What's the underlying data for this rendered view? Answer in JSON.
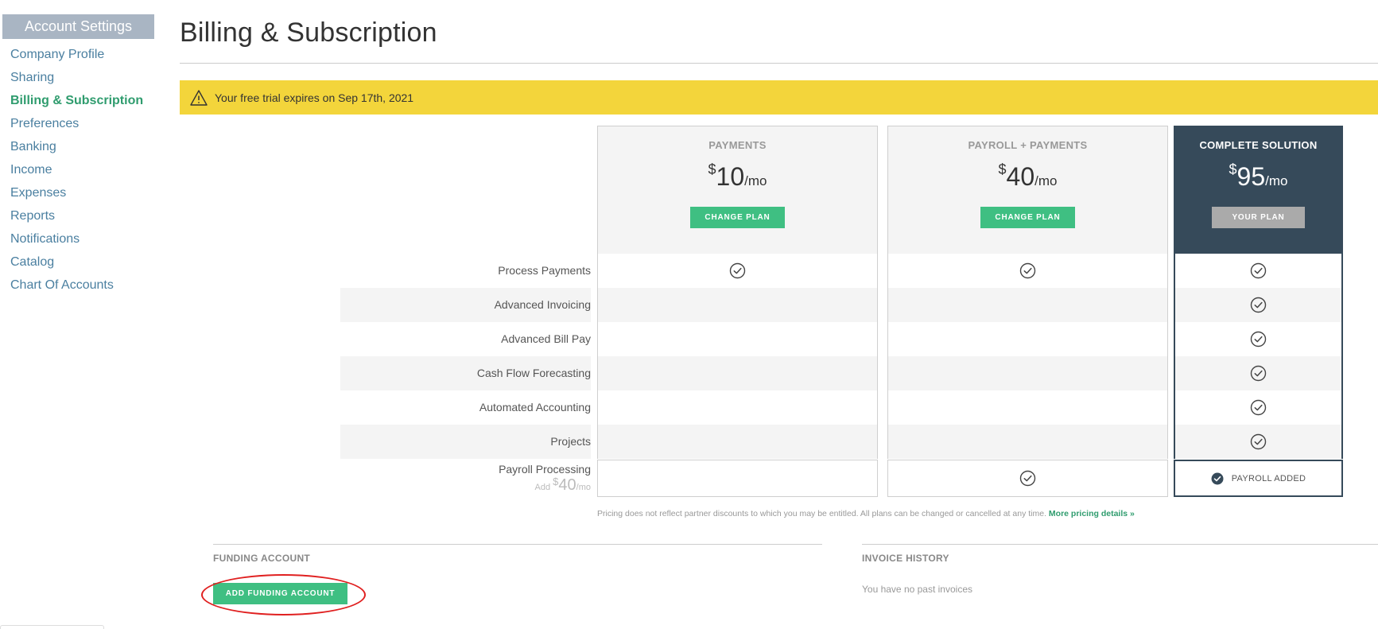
{
  "sidebar": {
    "header": "Account Settings",
    "items": [
      {
        "label": "Company Profile"
      },
      {
        "label": "Sharing"
      },
      {
        "label": "Billing & Subscription",
        "active": true
      },
      {
        "label": "Preferences"
      },
      {
        "label": "Banking"
      },
      {
        "label": "Income"
      },
      {
        "label": "Expenses"
      },
      {
        "label": "Reports"
      },
      {
        "label": "Notifications"
      },
      {
        "label": "Catalog"
      },
      {
        "label": "Chart Of Accounts"
      }
    ]
  },
  "page": {
    "title": "Billing & Subscription"
  },
  "banner": {
    "text": "Your free trial expires on Sep 17th, 2021",
    "icon": "warning-icon",
    "color": "#f3d53b"
  },
  "plans": [
    {
      "name": "PAYMENTS",
      "currency": "$",
      "price": "10",
      "unit": "/mo",
      "button": "CHANGE PLAN"
    },
    {
      "name": "PAYROLL + PAYMENTS",
      "currency": "$",
      "price": "40",
      "unit": "/mo",
      "button": "CHANGE PLAN"
    },
    {
      "name": "COMPLETE SOLUTION",
      "currency": "$",
      "price": "95",
      "unit": "/mo",
      "button": "YOUR PLAN",
      "current": true
    }
  ],
  "features": [
    {
      "label": "Process Payments",
      "included": [
        true,
        true,
        true
      ]
    },
    {
      "label": "Advanced Invoicing",
      "included": [
        false,
        false,
        true
      ]
    },
    {
      "label": "Advanced Bill Pay",
      "included": [
        false,
        false,
        true
      ]
    },
    {
      "label": "Cash Flow Forecasting",
      "included": [
        false,
        false,
        true
      ]
    },
    {
      "label": "Automated Accounting",
      "included": [
        false,
        false,
        true
      ]
    },
    {
      "label": "Projects",
      "included": [
        false,
        false,
        true
      ]
    }
  ],
  "payroll": {
    "label": "Payroll Processing",
    "add_prefix": "Add",
    "add_currency": "$",
    "add_price": "40",
    "add_unit": "/mo",
    "added_label": "PAYROLL ADDED"
  },
  "pricing_note": {
    "text": "Pricing does not reflect partner discounts to which you may be entitled. All plans can be changed or cancelled at any time.",
    "link": "More pricing details »"
  },
  "funding": {
    "title": "FUNDING ACCOUNT",
    "button": "ADD FUNDING ACCOUNT"
  },
  "invoices": {
    "title": "INVOICE HISTORY",
    "empty": "You have no past invoices"
  },
  "colors": {
    "accent_green": "#3fbf82",
    "link_blue": "#4a7fa0",
    "dark_plan": "#364a5a",
    "highlight_red": "#e02020"
  }
}
